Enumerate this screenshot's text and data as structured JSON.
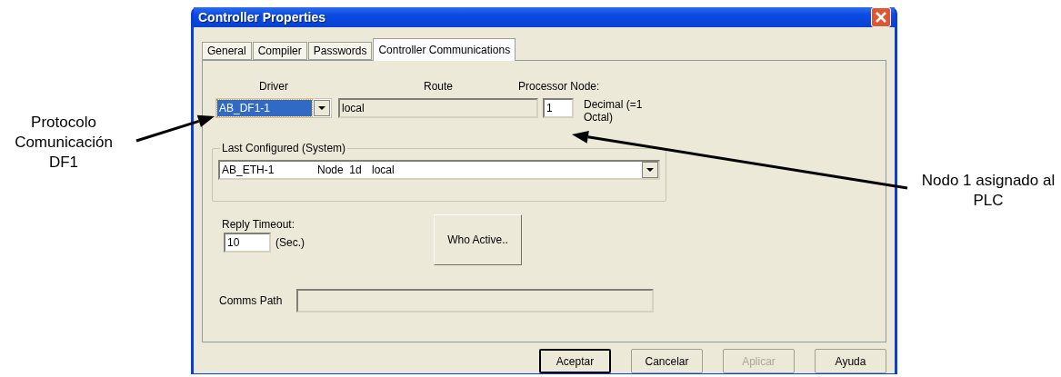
{
  "window": {
    "title": "Controller Properties"
  },
  "tabs": [
    {
      "label": "General",
      "selected": false
    },
    {
      "label": "Compiler",
      "selected": false
    },
    {
      "label": "Passwords",
      "selected": false
    },
    {
      "label": "Controller Communications",
      "selected": true
    }
  ],
  "driver": {
    "label": "Driver",
    "value": "AB_DF1-1",
    "highlighted": true
  },
  "route": {
    "label": "Route",
    "value": "local"
  },
  "processor_node": {
    "label": "Processor Node:",
    "value": "1",
    "note": "Decimal (=1 Octal)"
  },
  "last_configured": {
    "legend": "Last Configured (System)",
    "parts": [
      "AB_ETH-1",
      "Node  1d",
      "local"
    ]
  },
  "reply_timeout": {
    "label": "Reply Timeout:",
    "value": "10",
    "unit": "(Sec.)"
  },
  "who_active_button": {
    "label": "Who Active.."
  },
  "comms_path": {
    "label": "Comms Path"
  },
  "buttons": [
    {
      "label": "Aceptar",
      "default": true,
      "disabled": false
    },
    {
      "label": "Cancelar",
      "default": false,
      "disabled": false
    },
    {
      "label": "Aplicar",
      "default": false,
      "disabled": true
    },
    {
      "label": "Ayuda",
      "default": false,
      "disabled": false
    }
  ],
  "annotations": [
    {
      "text": "Protocolo Comunicación DF1"
    },
    {
      "text": "Nodo 1 asignado al PLC"
    }
  ]
}
